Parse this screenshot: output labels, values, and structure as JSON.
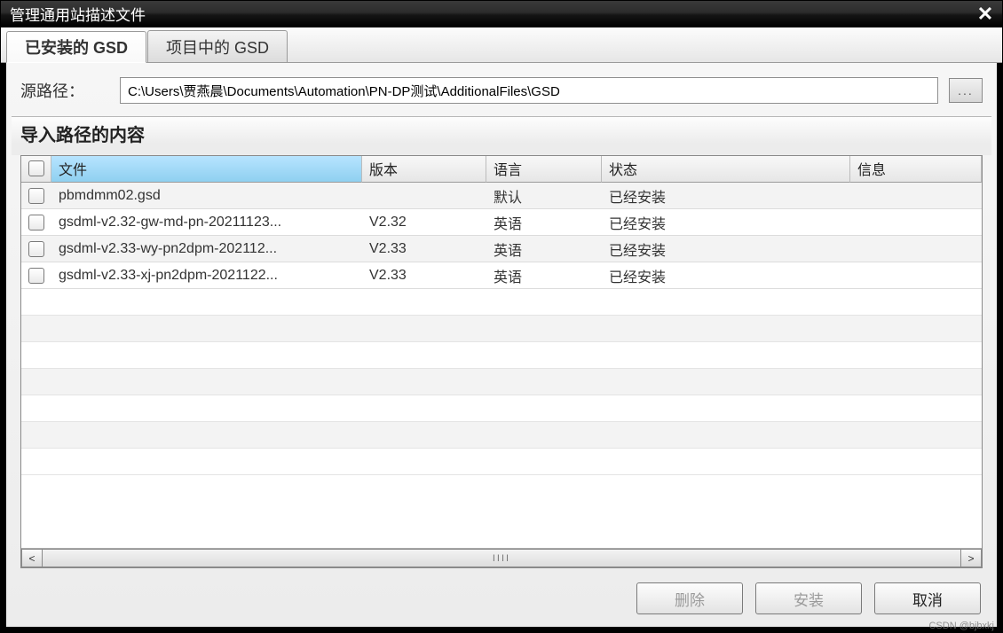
{
  "window": {
    "title": "管理通用站描述文件"
  },
  "tabs": {
    "installed": "已安装的 GSD",
    "project": "项目中的 GSD"
  },
  "path": {
    "label": "源路径：",
    "value": "C:\\Users\\贾燕晨\\Documents\\Automation\\PN-DP测试\\AdditionalFiles\\GSD",
    "browse": "..."
  },
  "section": {
    "header": "导入路径的内容"
  },
  "table": {
    "headers": {
      "file": "文件",
      "version": "版本",
      "language": "语言",
      "status": "状态",
      "info": "信息"
    },
    "rows": [
      {
        "file": "pbmdmm02.gsd",
        "version": "",
        "language": "默认",
        "status": "已经安装",
        "info": ""
      },
      {
        "file": "gsdml-v2.32-gw-md-pn-20211123...",
        "version": "V2.32",
        "language": "英语",
        "status": "已经安装",
        "info": ""
      },
      {
        "file": "gsdml-v2.33-wy-pn2dpm-202112...",
        "version": "V2.33",
        "language": "英语",
        "status": "已经安装",
        "info": ""
      },
      {
        "file": "gsdml-v2.33-xj-pn2dpm-2021122...",
        "version": "V2.33",
        "language": "英语",
        "status": "已经安装",
        "info": ""
      }
    ]
  },
  "buttons": {
    "delete": "删除",
    "install": "安装",
    "cancel": "取消"
  },
  "watermark": "CSDN @bjbxkj"
}
